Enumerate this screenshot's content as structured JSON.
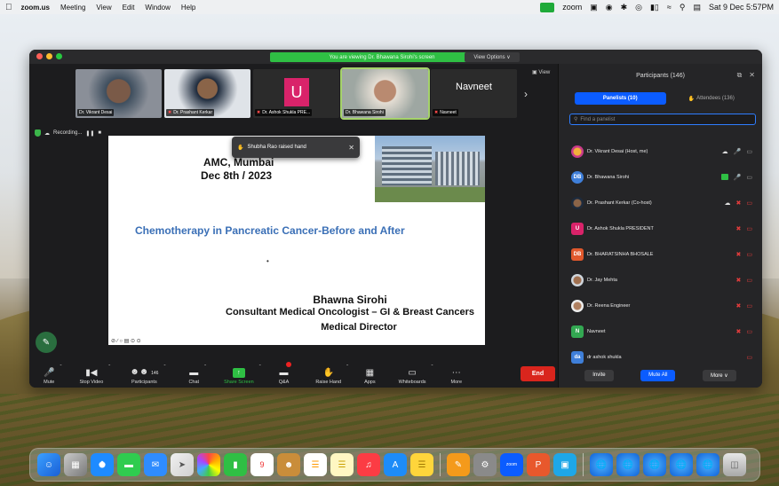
{
  "menubar": {
    "app": "zoom.us",
    "items": [
      "Meeting",
      "View",
      "Edit",
      "Window",
      "Help"
    ],
    "right_zoom": "zoom",
    "datetime": "Sat 9 Dec  5:57PM"
  },
  "titlebar": {
    "viewing_text": "You are viewing Dr. Bhawana Sirohi's screen",
    "view_options": "View Options ∨"
  },
  "thumbnails": [
    {
      "name": "Dr. Vikrant Desai",
      "muted": false
    },
    {
      "name": "Dr. Prashant Kerkar",
      "muted": true
    },
    {
      "name": "Dr. Ashok Shukla PRE...",
      "muted": true,
      "initial": "U"
    },
    {
      "name": "Dr. Bhawana Sirohi",
      "muted": false
    },
    {
      "name": "Navneet",
      "muted": true,
      "tile_text": "Navneet"
    }
  ],
  "view_label": "View",
  "recording_label": "Recording...",
  "toast": {
    "text": "Shubha Rao raised hand"
  },
  "slide": {
    "line1": "AMC, Mumbai",
    "line2": "Dec 8th / 2023",
    "heading": "Chemotherapy in Pancreatic Cancer-Before and After",
    "presenter": "Bhawna Sirohi",
    "role": "Consultant Medical Oncologist – GI & Breast Cancers",
    "position": "Medical Director",
    "tools": "⊘ ∕ ○ ▤ ⊙ ⊙"
  },
  "toolbar": {
    "items": [
      {
        "label": "Mute",
        "icon": "mic-icon"
      },
      {
        "label": "Stop Video",
        "icon": "video-icon"
      },
      {
        "label": "Participants",
        "icon": "participants-icon",
        "count": "146"
      },
      {
        "label": "Chat",
        "icon": "chat-icon"
      },
      {
        "label": "Share Screen",
        "icon": "share-screen-icon"
      },
      {
        "label": "Q&A",
        "icon": "qa-icon"
      },
      {
        "label": "Raise Hand",
        "icon": "raise-hand-icon"
      },
      {
        "label": "Apps",
        "icon": "apps-icon"
      },
      {
        "label": "Whiteboards",
        "icon": "whiteboard-icon"
      },
      {
        "label": "More",
        "icon": "more-icon"
      }
    ],
    "end": "End"
  },
  "panel": {
    "title": "Participants (146)",
    "tab_panelists": "Panelists (10)",
    "tab_attendees": "Attendees (136)",
    "search_placeholder": "Find a panelist",
    "participants": [
      {
        "name": "Dr. Vikrant Desai (Host, me)",
        "initials": "",
        "color": "#e07a2c"
      },
      {
        "name": "Dr. Bhawana Sirohi",
        "initials": "DB",
        "color": "#3f7fd9"
      },
      {
        "name": "Dr. Prashant Kerkar (Co-host)",
        "initials": "",
        "color": "#8a6a4a"
      },
      {
        "name": "Dr. Ashok Shukla PRESIDENT",
        "initials": "U",
        "color": "#d9236a"
      },
      {
        "name": "Dr. BHARATSINHA BHOSALE",
        "initials": "DB",
        "color": "#e0582c"
      },
      {
        "name": "Dr. Jay Mehta",
        "initials": "",
        "color": "#a07050"
      },
      {
        "name": "Dr. Reena Engineer",
        "initials": "",
        "color": "#b08060"
      },
      {
        "name": "Navneet",
        "initials": "N",
        "color": "#33a852"
      },
      {
        "name": "dr ashok shukla",
        "initials": "da",
        "color": "#3f7fd9"
      }
    ],
    "invite": "Invite",
    "mute_all": "Mute All",
    "more": "More ∨"
  },
  "colors": {
    "zoom_green": "#2fbf44",
    "zoom_blue": "#0b5cff",
    "end_red": "#d9251d",
    "slide_heading": "#3a6fb6"
  }
}
